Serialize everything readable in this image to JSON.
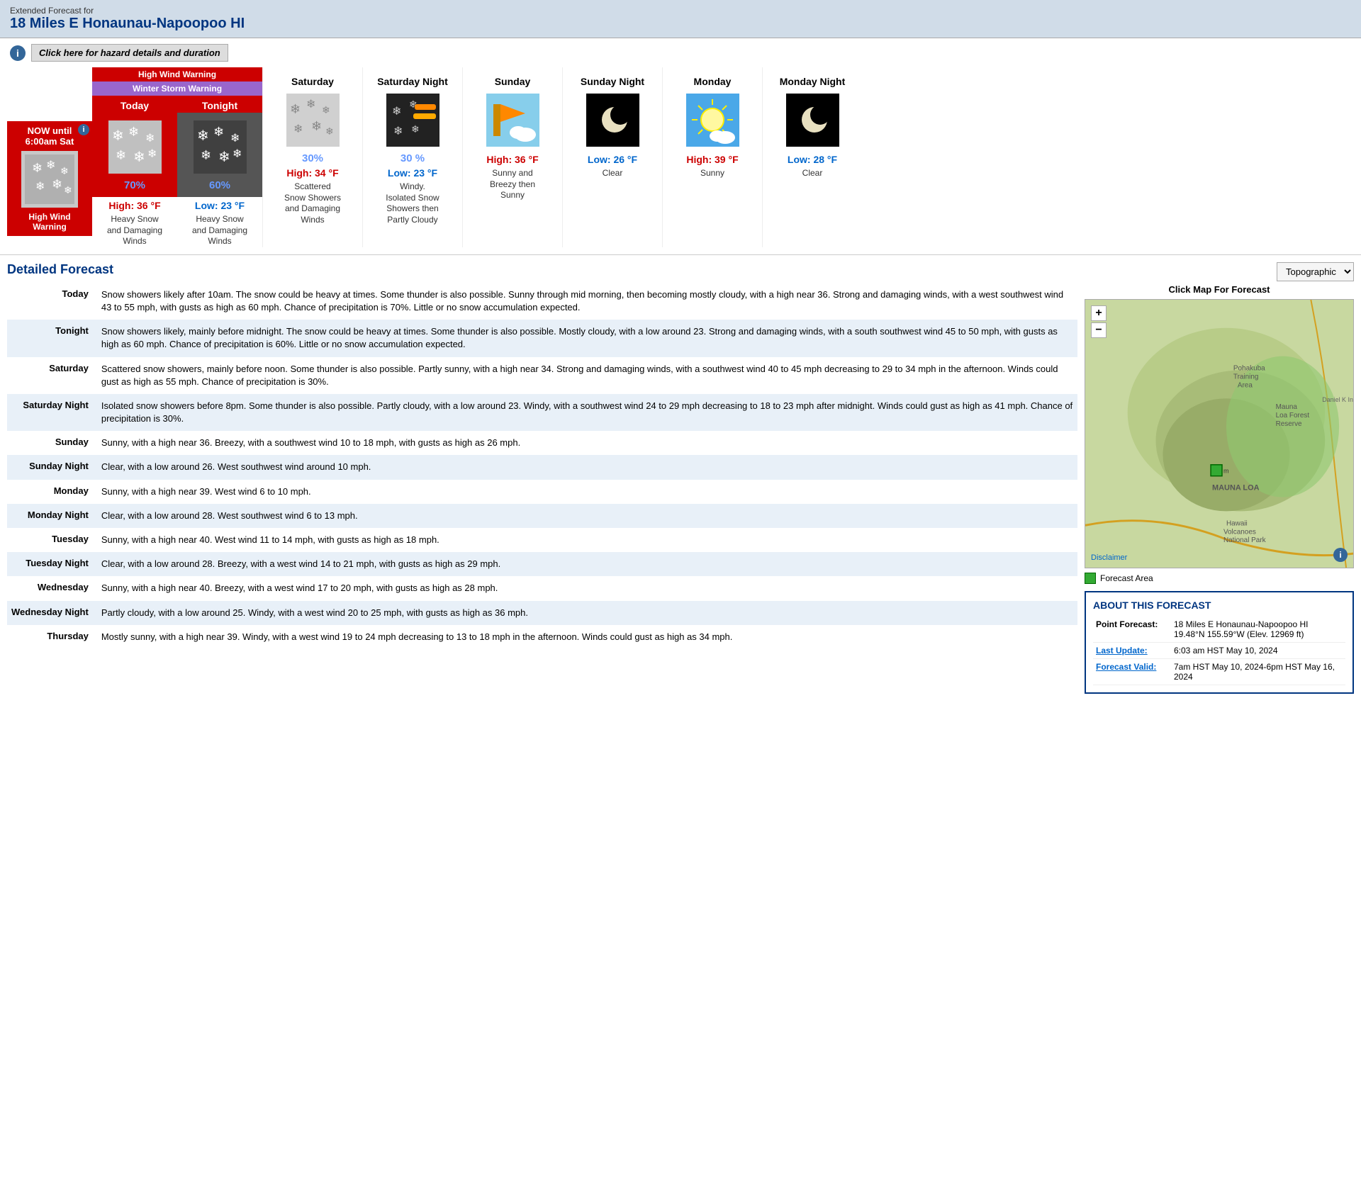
{
  "header": {
    "subtitle": "Extended Forecast for",
    "title": "18 Miles E Honaunau-Napoopoo HI"
  },
  "hazard": {
    "link_text": "Click here for hazard details and duration"
  },
  "warnings": {
    "high_wind": "High Wind Warning",
    "winter_storm": "Winter Storm Warning"
  },
  "now_period": {
    "label": "NOW until\n6:00am Sat",
    "warning": "High Wind\nWarning"
  },
  "forecasts": [
    {
      "period": "Today",
      "bg": "red",
      "precip": "70%",
      "temp_label": "High: 36 °F",
      "temp_type": "high",
      "desc": "Heavy Snow and Damaging Winds",
      "icon_type": "snow"
    },
    {
      "period": "Tonight",
      "bg": "dark",
      "precip": "60%",
      "temp_label": "Low: 23 °F",
      "temp_type": "low",
      "desc": "Heavy Snow and Damaging Winds",
      "icon_type": "snow_dark"
    },
    {
      "period": "Saturday",
      "bg": "white",
      "precip": "30%",
      "temp_label": "High: 34 °F",
      "temp_type": "high",
      "desc": "Scattered Snow Showers and Damaging Winds",
      "icon_type": "snow_scattered"
    },
    {
      "period": "Saturday Night",
      "bg": "white",
      "precip": "30 %",
      "temp_label": "Low: 23 °F",
      "temp_type": "low",
      "desc": "Windy. Isolated Snow Showers then Partly Cloudy",
      "icon_type": "snow_wind"
    },
    {
      "period": "Sunday",
      "bg": "white",
      "precip": "",
      "temp_label": "High: 36 °F",
      "temp_type": "high",
      "desc": "Sunny and Breezy then Sunny",
      "icon_type": "windy"
    },
    {
      "period": "Sunday Night",
      "bg": "white",
      "precip": "",
      "temp_label": "Low: 26 °F",
      "temp_type": "low",
      "desc": "Clear",
      "icon_type": "clear_night"
    },
    {
      "period": "Monday",
      "bg": "white",
      "precip": "",
      "temp_label": "High: 39 °F",
      "temp_type": "high",
      "desc": "Sunny",
      "icon_type": "sunny"
    },
    {
      "period": "Monday Night",
      "bg": "white",
      "precip": "",
      "temp_label": "Low: 28 °F",
      "temp_type": "low",
      "desc": "Clear",
      "icon_type": "clear_night"
    }
  ],
  "detailed_forecast": {
    "title": "Detailed Forecast",
    "periods": [
      {
        "name": "Today",
        "text": "Snow showers likely after 10am. The snow could be heavy at times. Some thunder is also possible. Sunny through mid morning, then becoming mostly cloudy, with a high near 36. Strong and damaging winds, with a west southwest wind 43 to 55 mph, with gusts as high as 60 mph. Chance of precipitation is 70%. Little or no snow accumulation expected."
      },
      {
        "name": "Tonight",
        "text": "Snow showers likely, mainly before midnight. The snow could be heavy at times. Some thunder is also possible. Mostly cloudy, with a low around 23. Strong and damaging winds, with a south southwest wind 45 to 50 mph, with gusts as high as 60 mph. Chance of precipitation is 60%. Little or no snow accumulation expected."
      },
      {
        "name": "Saturday",
        "text": "Scattered snow showers, mainly before noon. Some thunder is also possible. Partly sunny, with a high near 34. Strong and damaging winds, with a southwest wind 40 to 45 mph decreasing to 29 to 34 mph in the afternoon. Winds could gust as high as 55 mph. Chance of precipitation is 30%."
      },
      {
        "name": "Saturday Night",
        "text": "Isolated snow showers before 8pm. Some thunder is also possible. Partly cloudy, with a low around 23. Windy, with a southwest wind 24 to 29 mph decreasing to 18 to 23 mph after midnight. Winds could gust as high as 41 mph. Chance of precipitation is 30%."
      },
      {
        "name": "Sunday",
        "text": "Sunny, with a high near 36. Breezy, with a southwest wind 10 to 18 mph, with gusts as high as 26 mph."
      },
      {
        "name": "Sunday Night",
        "text": "Clear, with a low around 26. West southwest wind around 10 mph."
      },
      {
        "name": "Monday",
        "text": "Sunny, with a high near 39. West wind 6 to 10 mph."
      },
      {
        "name": "Monday Night",
        "text": "Clear, with a low around 28. West southwest wind 6 to 13 mph."
      },
      {
        "name": "Tuesday",
        "text": "Sunny, with a high near 40. West wind 11 to 14 mph, with gusts as high as 18 mph."
      },
      {
        "name": "Tuesday Night",
        "text": "Clear, with a low around 28. Breezy, with a west wind 14 to 21 mph, with gusts as high as 29 mph."
      },
      {
        "name": "Wednesday",
        "text": "Sunny, with a high near 40. Breezy, with a west wind 17 to 20 mph, with gusts as high as 28 mph."
      },
      {
        "name": "Wednesday Night",
        "text": "Partly cloudy, with a low around 25. Windy, with a west wind 20 to 25 mph, with gusts as high as 36 mph."
      },
      {
        "name": "Thursday",
        "text": "Mostly sunny, with a high near 39. Windy, with a west wind 19 to 24 mph decreasing to 13 to 18 mph in the afternoon. Winds could gust as high as 34 mph."
      }
    ]
  },
  "map": {
    "dropdown_label": "Topographic",
    "click_label": "Click Map For Forecast",
    "zoom_in": "+",
    "zoom_out": "−",
    "disclaimer_text": "Disclaimer",
    "forecast_area_label": "Forecast Area"
  },
  "about": {
    "title": "ABOUT THIS FORECAST",
    "point_forecast_label": "Point Forecast:",
    "point_forecast_value": "18 Miles E Honaunau-Napoopoo HI\n19.48°N 155.59°W (Elev. 12969 ft)",
    "last_update_label": "Last Update:",
    "last_update_value": "6:03 am HST May 10, 2024",
    "forecast_valid_label": "Forecast Valid:",
    "forecast_valid_value": "7am HST May 10, 2024-6pm HST May 16, 2024"
  }
}
